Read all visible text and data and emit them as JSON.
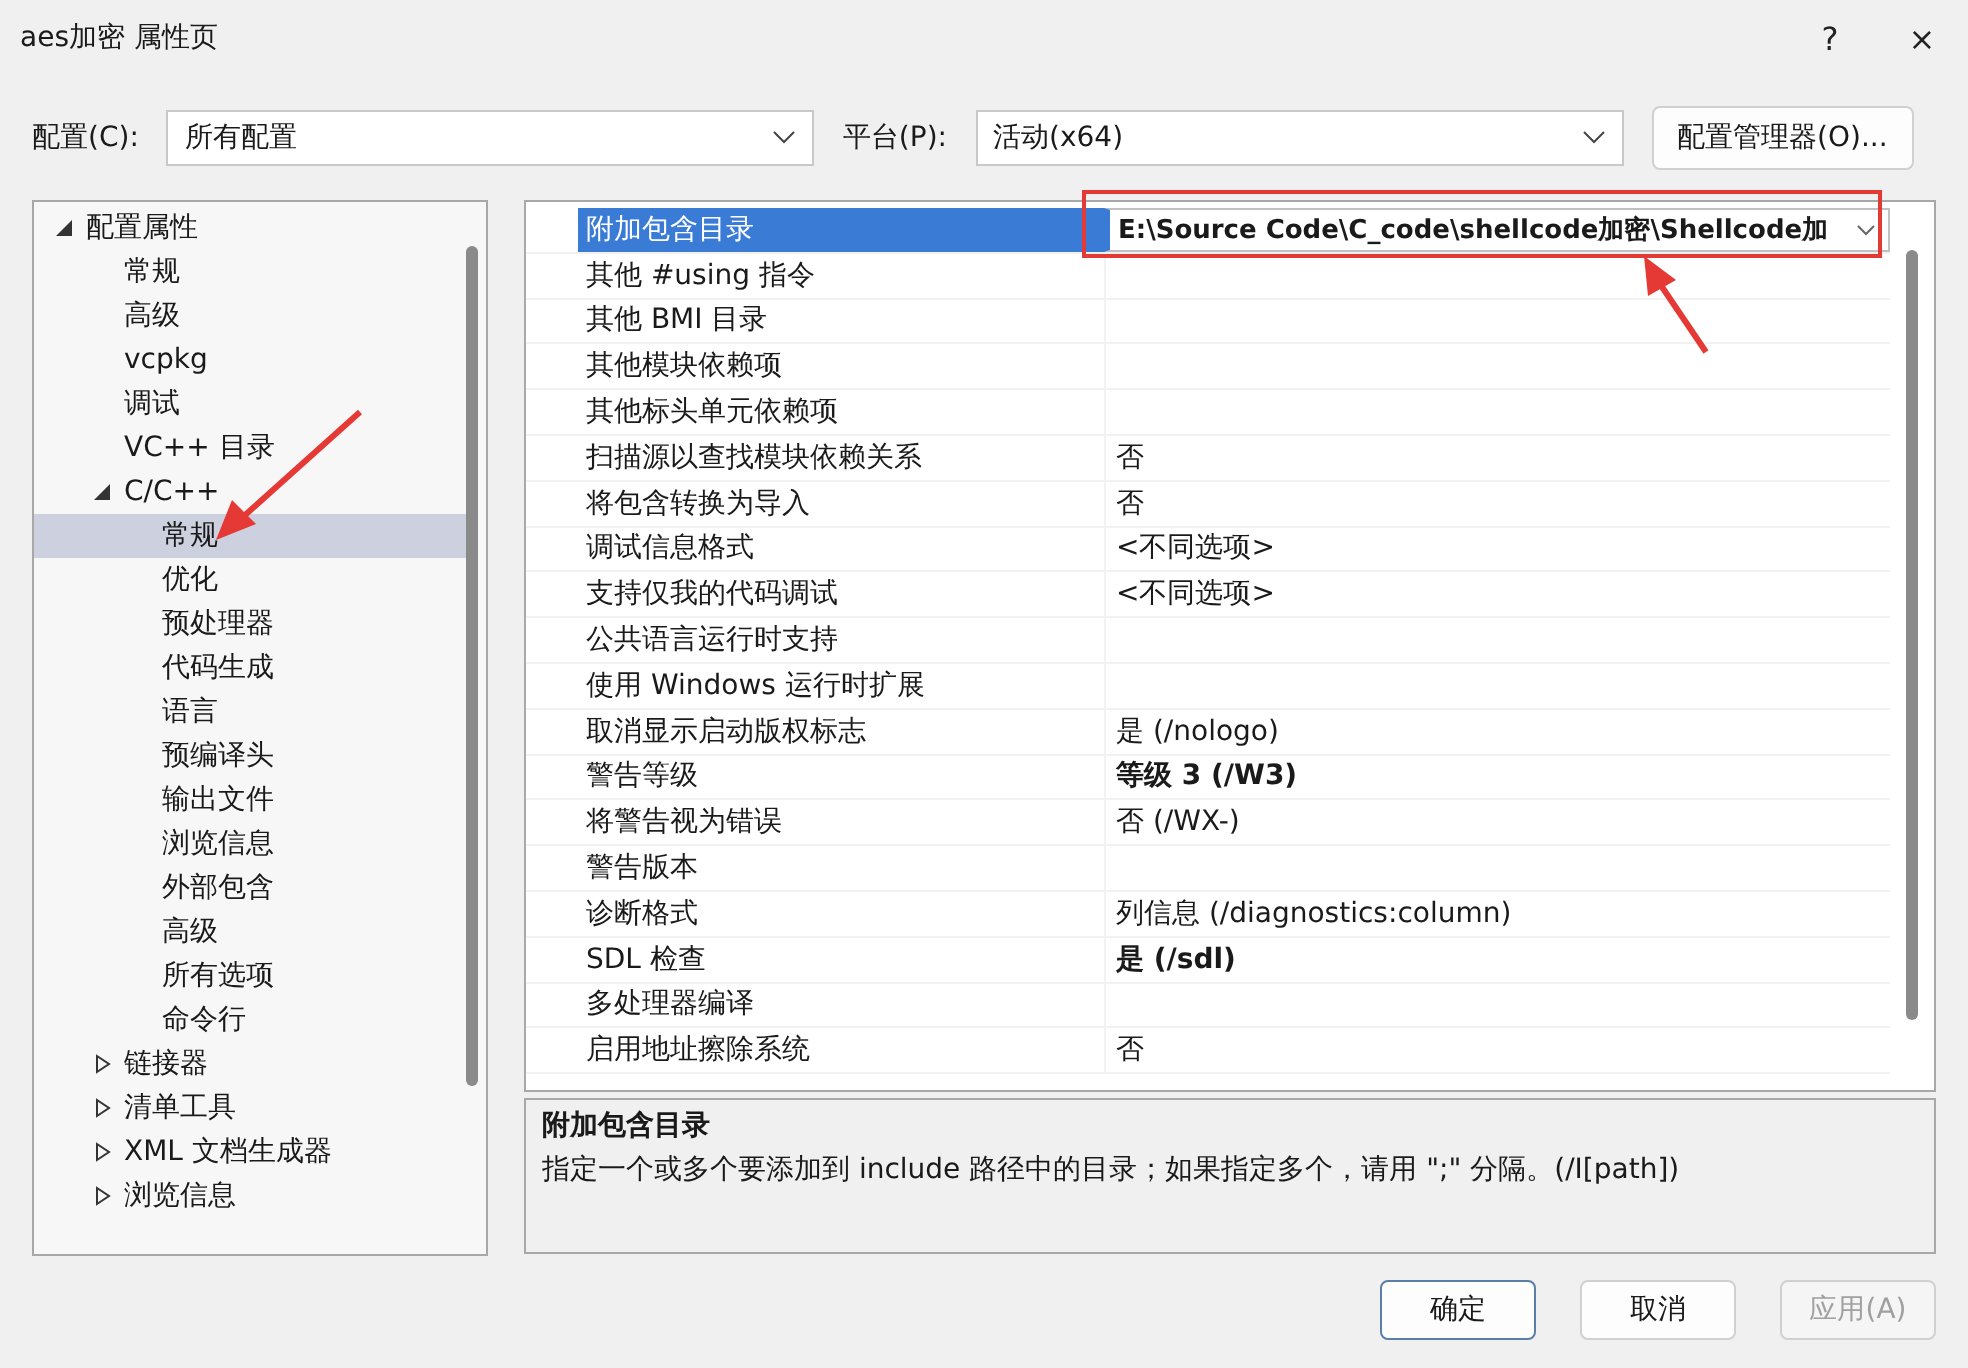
{
  "window": {
    "title": "aes加密 属性页",
    "help": "?",
    "close": "×"
  },
  "config_bar": {
    "config_label": "配置(C):",
    "config_value": "所有配置",
    "platform_label": "平台(P):",
    "platform_value": "活动(x64)",
    "manager_button": "配置管理器(O)..."
  },
  "tree": [
    {
      "label": "配置属性",
      "expanded": true,
      "selected": false,
      "children": [
        {
          "label": "常规",
          "selected": false
        },
        {
          "label": "高级",
          "selected": false
        },
        {
          "label": "vcpkg",
          "selected": false
        },
        {
          "label": "调试",
          "selected": false
        },
        {
          "label": "VC++ 目录",
          "selected": false
        },
        {
          "label": "C/C++",
          "expanded": true,
          "selected": false,
          "children": [
            {
              "label": "常规",
              "selected": true
            },
            {
              "label": "优化",
              "selected": false
            },
            {
              "label": "预处理器",
              "selected": false
            },
            {
              "label": "代码生成",
              "selected": false
            },
            {
              "label": "语言",
              "selected": false
            },
            {
              "label": "预编译头",
              "selected": false
            },
            {
              "label": "输出文件",
              "selected": false
            },
            {
              "label": "浏览信息",
              "selected": false
            },
            {
              "label": "外部包含",
              "selected": false
            },
            {
              "label": "高级",
              "selected": false
            },
            {
              "label": "所有选项",
              "selected": false
            },
            {
              "label": "命令行",
              "selected": false
            }
          ]
        },
        {
          "label": "链接器",
          "expanded": false,
          "selected": false
        },
        {
          "label": "清单工具",
          "expanded": false,
          "selected": false
        },
        {
          "label": "XML 文档生成器",
          "expanded": false,
          "selected": false
        },
        {
          "label": "浏览信息",
          "expanded": false,
          "selected": false
        }
      ]
    }
  ],
  "properties": [
    {
      "name": "附加包含目录",
      "value": "E:\\Source Code\\C_code\\shellcode加密\\Shellcode加",
      "bold": true,
      "selected": true
    },
    {
      "name": "其他 #using 指令",
      "selected": false
    },
    {
      "name": "其他 BMI 目录",
      "selected": false
    },
    {
      "name": "其他模块依赖项",
      "selected": false
    },
    {
      "name": "其他标头单元依赖项",
      "selected": false
    },
    {
      "name": "扫描源以查找模块依赖关系",
      "value": "否",
      "bold": false,
      "selected": false
    },
    {
      "name": "将包含转换为导入",
      "value": "否",
      "bold": false,
      "selected": false
    },
    {
      "name": "调试信息格式",
      "value": "<不同选项>",
      "bold": false,
      "selected": false
    },
    {
      "name": "支持仅我的代码调试",
      "value": "<不同选项>",
      "bold": false,
      "selected": false
    },
    {
      "name": "公共语言运行时支持",
      "selected": false
    },
    {
      "name": "使用 Windows 运行时扩展",
      "selected": false
    },
    {
      "name": "取消显示启动版权标志",
      "value": "是 (/nologo)",
      "bold": false,
      "selected": false
    },
    {
      "name": "警告等级",
      "value": "等级 3 (/W3)",
      "bold": true,
      "selected": false
    },
    {
      "name": "将警告视为错误",
      "value": "否 (/WX-)",
      "bold": false,
      "selected": false
    },
    {
      "name": "警告版本",
      "selected": false
    },
    {
      "name": "诊断格式",
      "value": "列信息 (/diagnostics:column)",
      "bold": false,
      "selected": false
    },
    {
      "name": "SDL 检查",
      "value": "是 (/sdl)",
      "bold": true,
      "selected": false
    },
    {
      "name": "多处理器编译",
      "selected": false
    },
    {
      "name": "启用地址擦除系统",
      "value": "否",
      "bold": false,
      "selected": false
    }
  ],
  "description": {
    "title": "附加包含目录",
    "text": "指定一个或多个要添加到 include 路径中的目录；如果指定多个，请用 \";\" 分隔。(/I[path])"
  },
  "buttons": [
    {
      "label": "确定",
      "disabled": false,
      "default": true
    },
    {
      "label": "取消",
      "disabled": false,
      "default": false
    },
    {
      "label": "应用(A)",
      "disabled": true,
      "default": false
    }
  ]
}
